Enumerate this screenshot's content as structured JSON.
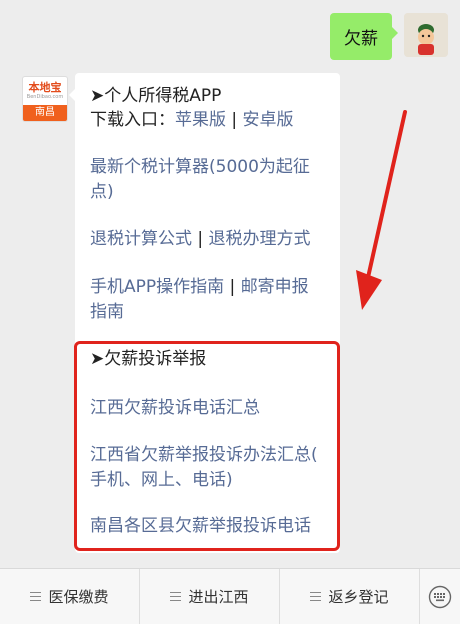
{
  "user_message": {
    "text": "欠薪"
  },
  "bot_avatar": {
    "brand": "本地宝",
    "domain": "BenDibao.com",
    "city": "南昌"
  },
  "reply": {
    "app_heading": "➤个人所得税APP",
    "download_label": "下载入口：",
    "download_apple": "苹果版",
    "download_sep": "|",
    "download_android": "安卓版",
    "calc_line1": "最新个税计算器(5000为起征",
    "calc_line2": "点)",
    "refund_formula": "退税计算公式",
    "refund_sep": "|",
    "refund_method": "退税办理方式",
    "app_guide_line1": "手机APP操作指南",
    "app_guide_sep": "|",
    "mail_report": "邮寄申报",
    "app_guide_line2": "指南",
    "wage_heading": "➤欠薪投诉举报",
    "wage_link1": "江西欠薪投诉电话汇总",
    "wage_link2_line1": "江西省欠薪举报投诉办法汇总(",
    "wage_link2_line2": "手机、网上、电话)",
    "wage_link3": "南昌各区县欠薪举报投诉电话"
  },
  "tabbar": {
    "tab1": "医保缴费",
    "tab2": "进出江西",
    "tab3": "返乡登记",
    "keyboard_icon": "keyboard-icon"
  },
  "colors": {
    "user_bubble": "#95ec69",
    "link": "#576b95",
    "highlight": "#e0231c"
  }
}
